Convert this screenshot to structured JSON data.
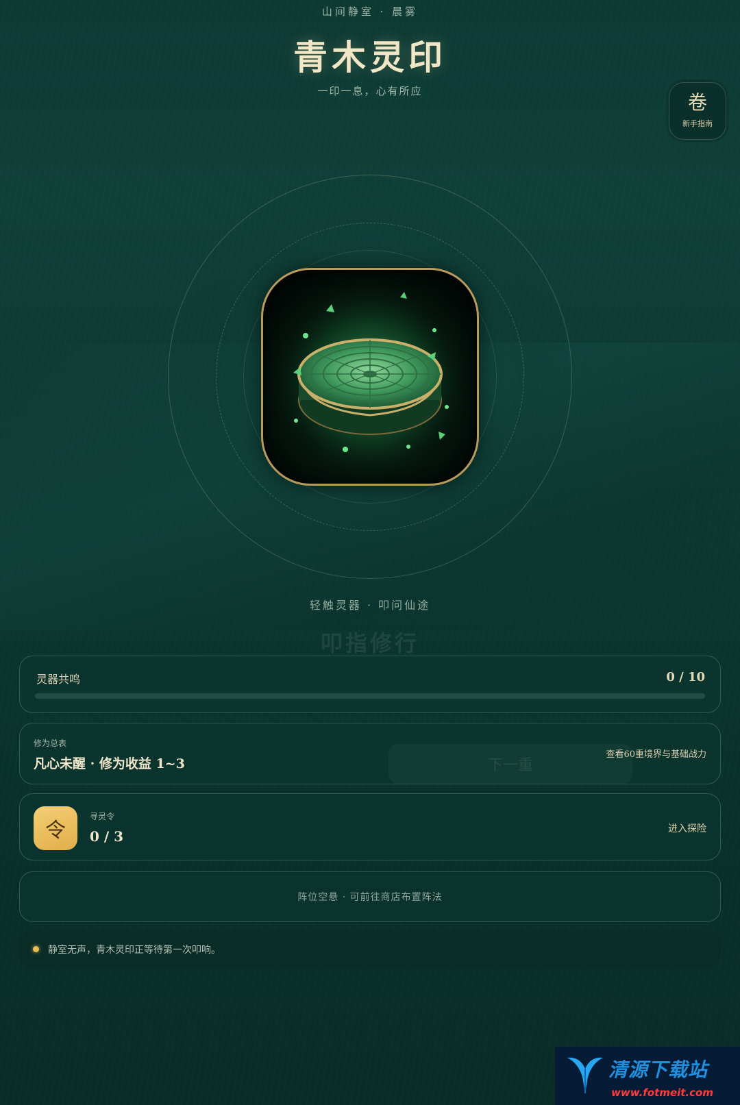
{
  "header": {
    "location": "山间静室 · 晨雾",
    "title": "青木灵印",
    "tagline": "一印一息，心有所应"
  },
  "guide": {
    "glyph": "卷",
    "label": "新手指南"
  },
  "artifact": {
    "instruction": "轻触灵器 · 叩问仙途",
    "ghost_title": "叩指修行"
  },
  "resonance": {
    "label": "灵器共鸣",
    "count": "0 / 10",
    "progress_fraction": 0.0
  },
  "cultivation": {
    "caption": "修为总表",
    "value": "凡心未醒 · 修为收益 1~3",
    "ghost_button": "下一重",
    "link": "查看60重境界与基础战力"
  },
  "token": {
    "glyph": "令",
    "caption": "寻灵令",
    "count": "0 / 3",
    "link": "进入探险"
  },
  "formation": {
    "text": "阵位空悬 · 可前往商店布置阵法"
  },
  "status": {
    "text": "静室无声，青木灵印正等待第一次叩响。"
  },
  "watermark": {
    "name": "清源下载站",
    "url": "www.fotmeit.com"
  },
  "colors": {
    "background": "#0d3a33",
    "accent_gold": "#d8b45a",
    "token_yellow": "#f3cf74",
    "text_cream": "#efe6cc"
  }
}
